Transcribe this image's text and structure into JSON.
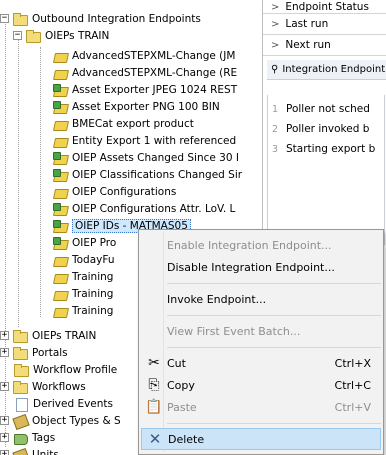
{
  "tree": {
    "root": "Outbound Integration Endpoints",
    "group": "OIEPs TRAIN",
    "endpoints": [
      {
        "label": "AdvancedSTEPXML-Change (JM",
        "icon": "endpoint-icon"
      },
      {
        "label": "AdvancedSTEPXML-Change (RE",
        "icon": "endpoint-icon"
      },
      {
        "label": "Asset Exporter JPEG 1024 REST",
        "icon": "endpoint-active-icon"
      },
      {
        "label": "Asset Exporter PNG 100 BIN",
        "icon": "endpoint-active-icon"
      },
      {
        "label": "BMECat export product",
        "icon": "endpoint-icon"
      },
      {
        "label": "Entity Export 1 with referenced",
        "icon": "endpoint-icon"
      },
      {
        "label": "OIEP Assets Changed Since 30 I",
        "icon": "endpoint-active-icon"
      },
      {
        "label": "OIEP Classifications Changed Sir",
        "icon": "endpoint-active-icon"
      },
      {
        "label": "OIEP Configurations",
        "icon": "endpoint-icon"
      },
      {
        "label": "OIEP Configurations Attr. LoV. L",
        "icon": "endpoint-active-icon"
      },
      {
        "label": "OIEP IDs - MATMAS05",
        "icon": "endpoint-active-icon",
        "selected": true
      },
      {
        "label": "OIEP Pro",
        "icon": "endpoint-active-icon"
      },
      {
        "label": "TodayFu",
        "icon": "endpoint-icon"
      },
      {
        "label": "Training",
        "icon": "endpoint-icon"
      },
      {
        "label": "Training",
        "icon": "endpoint-icon"
      },
      {
        "label": "Training",
        "icon": "endpoint-icon"
      }
    ],
    "group2": "OIEPs TRAIN",
    "top_level": [
      {
        "label": "Portals",
        "expander": "+",
        "icon": "folder-icon"
      },
      {
        "label": "Workflow Profile",
        "expander": "",
        "icon": "folder-icon"
      },
      {
        "label": "Workflows",
        "expander": "+",
        "icon": "folder-icon"
      },
      {
        "label": "Derived Events",
        "expander": "",
        "icon": "document-icon"
      },
      {
        "label": "Object Types & S",
        "expander": "+",
        "icon": "object-types-icon"
      },
      {
        "label": "Tags",
        "expander": "+",
        "icon": "tags-icon"
      },
      {
        "label": "Units",
        "expander": "+",
        "icon": "units-icon"
      }
    ]
  },
  "right_panel": {
    "rows": [
      {
        "label": "Endpoint Status"
      },
      {
        "label": "Last run"
      },
      {
        "label": "Next run"
      }
    ],
    "section_header": "Integration Endpoint",
    "log": [
      {
        "num": "1",
        "text": "Poller not sched"
      },
      {
        "num": "2",
        "text": "Poller invoked b"
      },
      {
        "num": "3",
        "text": "Starting export b"
      }
    ]
  },
  "context_menu": {
    "items": [
      {
        "label": "Enable Integration Endpoint...",
        "shortcut": "",
        "disabled": true,
        "icon": ""
      },
      {
        "label": "Disable Integration Endpoint...",
        "shortcut": "",
        "disabled": false,
        "icon": ""
      },
      {
        "label": "Invoke Endpoint...",
        "shortcut": "",
        "disabled": false,
        "icon": ""
      },
      {
        "label": "View First Event Batch...",
        "shortcut": "",
        "disabled": true,
        "icon": ""
      },
      {
        "label": "Cut",
        "shortcut": "Ctrl+X",
        "disabled": false,
        "icon": "scissors-icon"
      },
      {
        "label": "Copy",
        "shortcut": "Ctrl+C",
        "disabled": false,
        "icon": "copy-icon"
      },
      {
        "label": "Paste",
        "shortcut": "Ctrl+V",
        "disabled": true,
        "icon": "paste-icon"
      },
      {
        "label": "Delete",
        "shortcut": "",
        "disabled": false,
        "icon": "delete-icon",
        "highlighted": true
      }
    ]
  },
  "colors": {
    "selection": "#cde8ff",
    "menu_highlight": "#cce4f7",
    "menu_bg": "#f2f2f2",
    "folder": "#f3dd7a",
    "endpoint_active": "#4aa345"
  }
}
